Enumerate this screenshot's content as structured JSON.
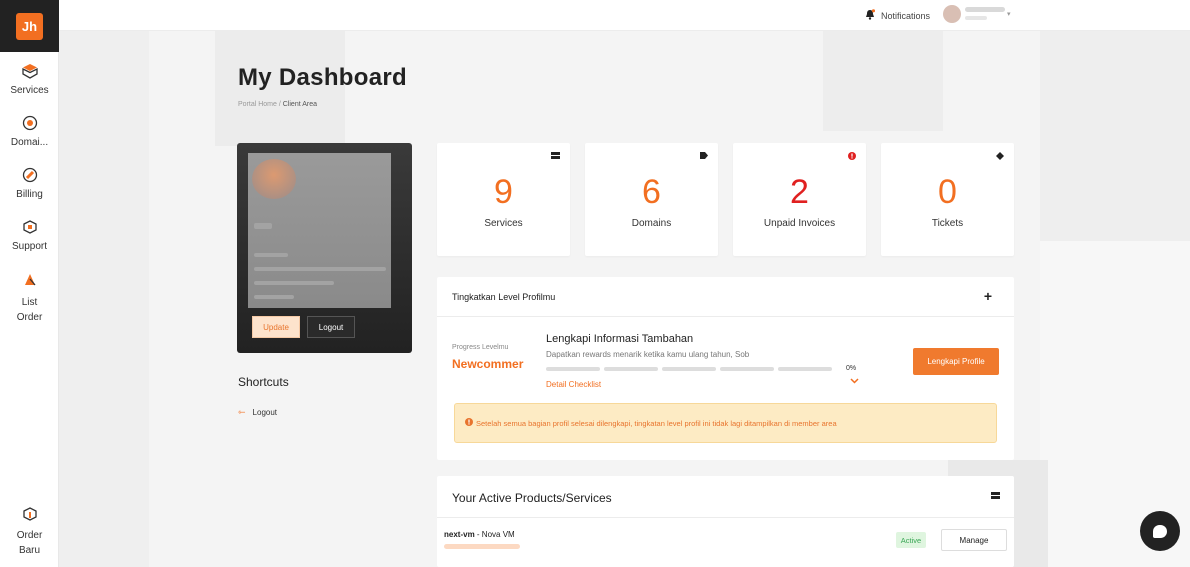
{
  "sidebar": {
    "logo": "Jh",
    "items": [
      {
        "label": "Services",
        "icon": "box-icon"
      },
      {
        "label": "Domai...",
        "icon": "globe-icon"
      },
      {
        "label": "Billing",
        "icon": "billing-icon"
      },
      {
        "label": "Support",
        "icon": "support-icon"
      },
      {
        "label": "List\nOrder",
        "label1": "List",
        "label2": "Order",
        "icon": "order-list-icon"
      },
      {
        "label1": "Order",
        "label2": "Baru",
        "icon": "new-order-icon"
      }
    ]
  },
  "topbar": {
    "notifications": "Notifications"
  },
  "header": {
    "title": "My Dashboard",
    "breadcrumb_home": "Portal Home",
    "breadcrumb_sep": "/",
    "breadcrumb_current": "Client Area"
  },
  "profile": {
    "update_label": "Update",
    "logout_label": "Logout"
  },
  "shortcuts": {
    "title": "Shortcuts",
    "logout": "Logout"
  },
  "stats": [
    {
      "value": "9",
      "label": "Services",
      "icon": "server-icon"
    },
    {
      "value": "6",
      "label": "Domains",
      "icon": "tag-icon"
    },
    {
      "value": "2",
      "label": "Unpaid Invoices",
      "icon": "alert-icon"
    },
    {
      "value": "0",
      "label": "Tickets",
      "icon": "ticket-icon"
    }
  ],
  "level": {
    "title": "Tingkatkan Level Profilmu",
    "plus": "+",
    "progress_label": "Progress Levelmu",
    "progress_level": "Newcommer",
    "info_title": "Lengkapi Informasi Tambahan",
    "info_sub": "Dapatkan rewards menarik ketika kamu ulang tahun, Sob",
    "percent": "0%",
    "progress_fraction": 0,
    "detail_link": "Detail Checklist",
    "button": "Lengkapi Profile",
    "alert": "Setelah semua bagian profil selesai dilengkapi, tingkatan level profil ini tidak lagi ditampilkan di member area"
  },
  "products": {
    "title": "Your Active Products/Services",
    "items": [
      {
        "name": "next-vm",
        "sep": " - ",
        "product": "Nova VM",
        "status": "Active",
        "action": "Manage"
      }
    ]
  },
  "colors": {
    "accent": "#f26f21",
    "danger": "#e02020",
    "success": "#3aa655",
    "sidebar_dark": "#222222"
  }
}
